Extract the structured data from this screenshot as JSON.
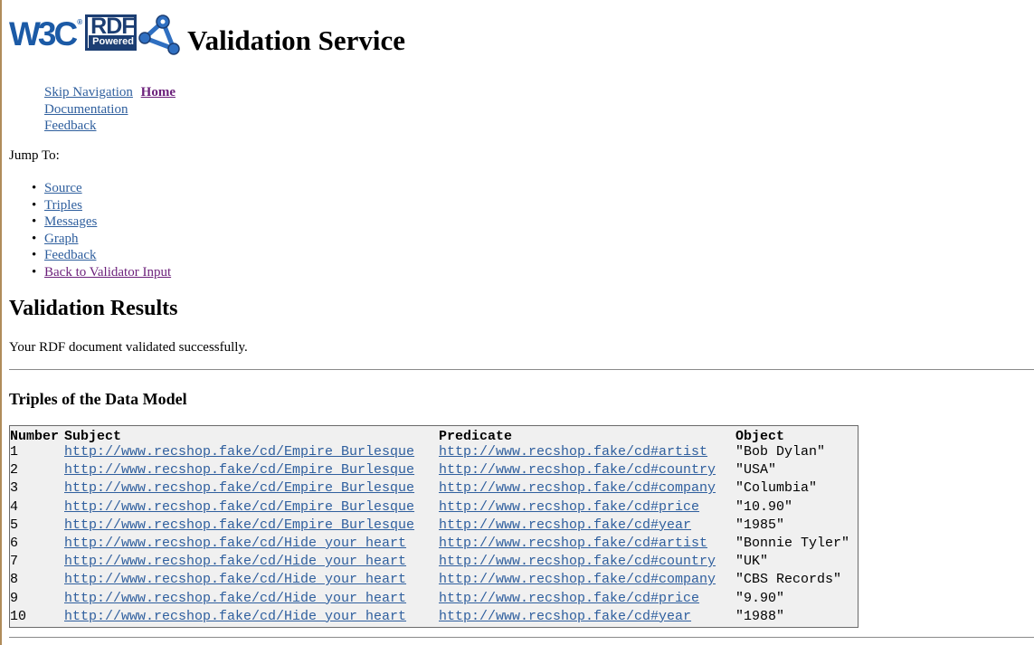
{
  "header": {
    "w3c_logo_text": "W3C",
    "rdf_logo_text": "RDF",
    "rdf_logo_sub": "Powered",
    "title": "Validation Service"
  },
  "skipnav": {
    "skip_label": "Skip Navigation",
    "home_label": "Home",
    "documentation_label": "Documentation",
    "feedback_label": "Feedback"
  },
  "jump": {
    "label": "Jump To:",
    "links": [
      "Source",
      "Triples",
      "Messages",
      "Graph",
      "Feedback",
      "Back to Validator Input"
    ]
  },
  "results": {
    "title": "Validation Results",
    "message": "Your RDF document validated successfully."
  },
  "triples": {
    "title": "Triples of the Data Model",
    "headers": [
      "Number",
      "Subject",
      "Predicate",
      "Object"
    ],
    "rows": [
      [
        "1",
        "http://www.recshop.fake/cd/Empire Burlesque",
        "http://www.recshop.fake/cd#artist",
        "\"Bob Dylan\""
      ],
      [
        "2",
        "http://www.recshop.fake/cd/Empire Burlesque",
        "http://www.recshop.fake/cd#country",
        "\"USA\""
      ],
      [
        "3",
        "http://www.recshop.fake/cd/Empire Burlesque",
        "http://www.recshop.fake/cd#company",
        "\"Columbia\""
      ],
      [
        "4",
        "http://www.recshop.fake/cd/Empire Burlesque",
        "http://www.recshop.fake/cd#price",
        "\"10.90\""
      ],
      [
        "5",
        "http://www.recshop.fake/cd/Empire Burlesque",
        "http://www.recshop.fake/cd#year",
        "\"1985\""
      ],
      [
        "6",
        "http://www.recshop.fake/cd/Hide your heart",
        "http://www.recshop.fake/cd#artist",
        "\"Bonnie Tyler\""
      ],
      [
        "7",
        "http://www.recshop.fake/cd/Hide your heart",
        "http://www.recshop.fake/cd#country",
        "\"UK\""
      ],
      [
        "8",
        "http://www.recshop.fake/cd/Hide your heart",
        "http://www.recshop.fake/cd#company",
        "\"CBS Records\""
      ],
      [
        "9",
        "http://www.recshop.fake/cd/Hide your heart",
        "http://www.recshop.fake/cd#price",
        "\"9.90\""
      ],
      [
        "10",
        "http://www.recshop.fake/cd/Hide your heart",
        "http://www.recshop.fake/cd#year",
        "\"1988\""
      ]
    ]
  },
  "colors": {
    "link": "#2f5f9e",
    "visited_link": "#6b1f7a",
    "table_bg": "#f0f0f0"
  }
}
